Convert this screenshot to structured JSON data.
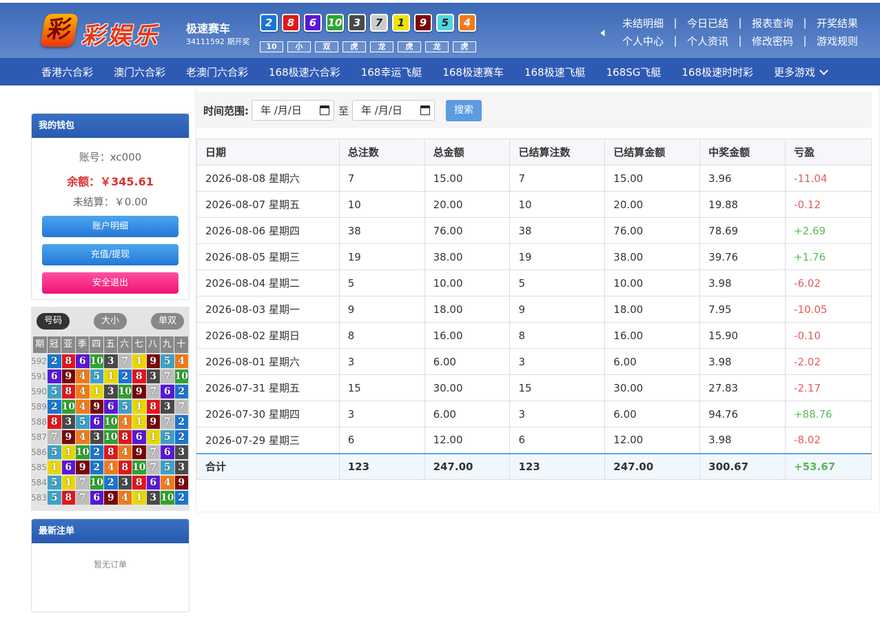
{
  "header": {
    "logo_badge": "彩",
    "logo_text": "彩娱乐",
    "game_name": "极速赛车",
    "issue": "34111592 期开奖",
    "result_balls": [
      {
        "n": "2",
        "color": "#1a76d2"
      },
      {
        "n": "8",
        "color": "#e4161b"
      },
      {
        "n": "6",
        "color": "#5a17d8"
      },
      {
        "n": "10",
        "color": "#2ea52e"
      },
      {
        "n": "3",
        "color": "#4a4a4a"
      },
      {
        "n": "7",
        "color": "#cccccc"
      },
      {
        "n": "1",
        "color": "#eee200"
      },
      {
        "n": "9",
        "color": "#7a0707"
      },
      {
        "n": "5",
        "color": "#4fd5e0"
      },
      {
        "n": "4",
        "color": "#f07b18"
      }
    ],
    "result_stats": [
      "10",
      "小",
      "双",
      "虎",
      "龙",
      "虎",
      "龙",
      "虎"
    ],
    "links_row1": [
      "未结明细",
      "今日已结",
      "报表查询",
      "开奖结果"
    ],
    "links_row2": [
      "个人中心",
      "个人资讯",
      "修改密码",
      "游戏规则"
    ]
  },
  "nav": [
    "香港六合彩",
    "澳门六合彩",
    "老澳门六合彩",
    "168极速六合彩",
    "168幸运飞艇",
    "168极速赛车",
    "168极速飞艇",
    "168SG飞艇",
    "168极速时时彩",
    "更多游戏"
  ],
  "wallet": {
    "title": "我的钱包",
    "account": "账号：xc000",
    "balance": "余额：￥345.61",
    "pending": "未结算：￥0.00",
    "btn_detail": "账户明细",
    "btn_recharge": "充值/提现",
    "btn_logout": "安全退出"
  },
  "history": {
    "tabs": [
      "号码",
      "大小",
      "单双"
    ],
    "head": [
      "期",
      "冠",
      "亚",
      "季",
      "四",
      "五",
      "六",
      "七",
      "八",
      "九",
      "十"
    ],
    "rows": [
      {
        "issue": "592",
        "nums": [
          2,
          8,
          6,
          10,
          3,
          7,
          1,
          9,
          5,
          4
        ]
      },
      {
        "issue": "591",
        "nums": [
          6,
          9,
          4,
          5,
          1,
          2,
          8,
          3,
          7,
          10
        ]
      },
      {
        "issue": "590",
        "nums": [
          5,
          8,
          4,
          1,
          3,
          10,
          9,
          7,
          6,
          2
        ]
      },
      {
        "issue": "589",
        "nums": [
          2,
          10,
          4,
          9,
          6,
          5,
          1,
          8,
          3,
          7
        ]
      },
      {
        "issue": "588",
        "nums": [
          8,
          3,
          5,
          6,
          10,
          4,
          1,
          9,
          7,
          2
        ]
      },
      {
        "issue": "587",
        "nums": [
          7,
          9,
          4,
          3,
          10,
          8,
          6,
          1,
          5,
          2
        ]
      },
      {
        "issue": "586",
        "nums": [
          5,
          1,
          10,
          2,
          8,
          4,
          9,
          7,
          6,
          3
        ]
      },
      {
        "issue": "585",
        "nums": [
          1,
          6,
          9,
          2,
          4,
          8,
          10,
          7,
          5,
          3
        ]
      },
      {
        "issue": "584",
        "nums": [
          5,
          1,
          7,
          10,
          2,
          3,
          8,
          6,
          4,
          9
        ]
      },
      {
        "issue": "583",
        "nums": [
          5,
          8,
          7,
          6,
          9,
          4,
          1,
          3,
          10,
          2
        ]
      }
    ],
    "colors": {
      "1": "#e8d800",
      "2": "#1a76d2",
      "3": "#4a4a4a",
      "4": "#f07b18",
      "5": "#3ea2c8",
      "6": "#5a17d8",
      "7": "#bdbdbd",
      "8": "#e4161b",
      "9": "#7a0707",
      "10": "#2ea52e"
    }
  },
  "latest": {
    "title": "最新注单",
    "empty": "暂无订单"
  },
  "filter": {
    "label": "时间范围:",
    "date_from": "年 /月/日",
    "to": "至",
    "date_to": "年 /月/日",
    "search": "搜索"
  },
  "table": {
    "headers": [
      "日期",
      "总注数",
      "总金额",
      "已结算注数",
      "已结算金额",
      "中奖金额",
      "亏盈"
    ],
    "rows": [
      [
        "2026-08-08 星期六",
        "7",
        "15.00",
        "7",
        "15.00",
        "3.96",
        "-11.04"
      ],
      [
        "2026-08-07 星期五",
        "10",
        "20.00",
        "10",
        "20.00",
        "19.88",
        "-0.12"
      ],
      [
        "2026-08-06 星期四",
        "38",
        "76.00",
        "38",
        "76.00",
        "78.69",
        "+2.69"
      ],
      [
        "2026-08-05 星期三",
        "19",
        "38.00",
        "19",
        "38.00",
        "39.76",
        "+1.76"
      ],
      [
        "2026-08-04 星期二",
        "5",
        "10.00",
        "5",
        "10.00",
        "3.98",
        "-6.02"
      ],
      [
        "2026-08-03 星期一",
        "9",
        "18.00",
        "9",
        "18.00",
        "7.95",
        "-10.05"
      ],
      [
        "2026-08-02 星期日",
        "8",
        "16.00",
        "8",
        "16.00",
        "15.90",
        "-0.10"
      ],
      [
        "2026-08-01 星期六",
        "3",
        "6.00",
        "3",
        "6.00",
        "3.98",
        "-2.02"
      ],
      [
        "2026-07-31 星期五",
        "15",
        "30.00",
        "15",
        "30.00",
        "27.83",
        "-2.17"
      ],
      [
        "2026-07-30 星期四",
        "3",
        "6.00",
        "3",
        "6.00",
        "94.76",
        "+88.76"
      ],
      [
        "2026-07-29 星期三",
        "6",
        "12.00",
        "6",
        "12.00",
        "3.98",
        "-8.02"
      ]
    ],
    "total": [
      "合计",
      "123",
      "247.00",
      "123",
      "247.00",
      "300.67",
      "+53.67"
    ],
    "pos_color": "#5cb85c",
    "neg_color": "#e85a5a"
  }
}
